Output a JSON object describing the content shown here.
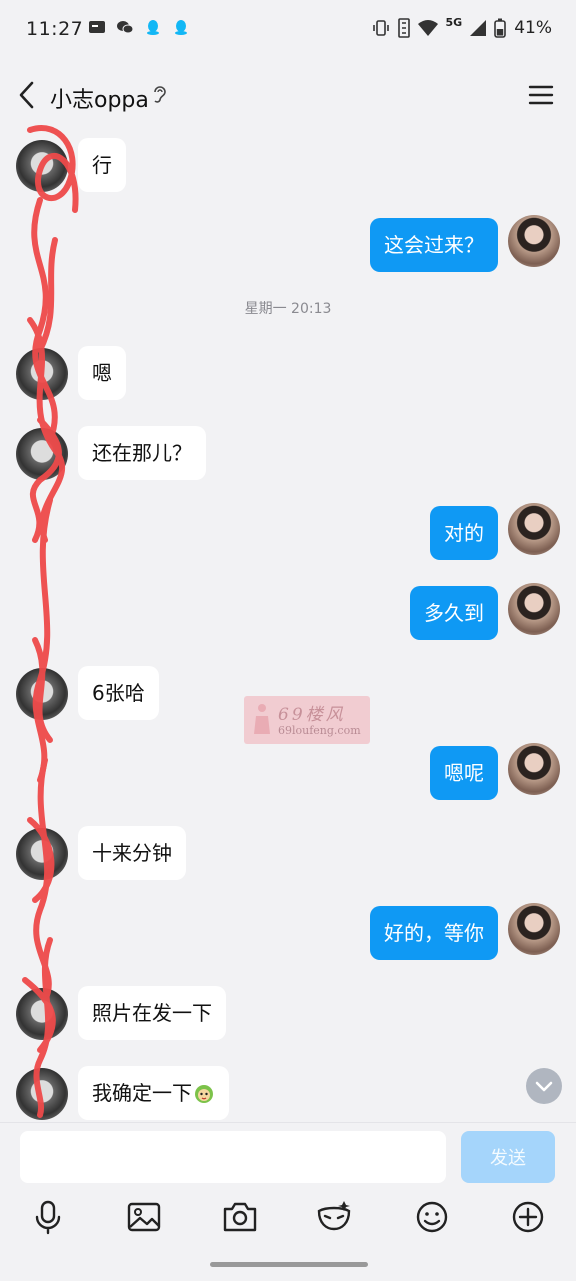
{
  "status": {
    "time": "11:27",
    "network": "5G",
    "battery": "41%"
  },
  "header": {
    "title": "小志oppa"
  },
  "timestamp": "星期一 20:13",
  "messages": [
    {
      "side": "recv",
      "text": "行"
    },
    {
      "side": "sent",
      "text": "这会过来？"
    },
    {
      "side": "recv",
      "text": "嗯"
    },
    {
      "side": "recv",
      "text": "还在那儿？"
    },
    {
      "side": "sent",
      "text": "对的"
    },
    {
      "side": "sent",
      "text": "多久到"
    },
    {
      "side": "recv",
      "text": "6张哈"
    },
    {
      "side": "sent",
      "text": "嗯呢"
    },
    {
      "side": "recv",
      "text": "十来分钟"
    },
    {
      "side": "sent",
      "text": "好的，等你"
    },
    {
      "side": "recv",
      "text": "照片在发一下"
    },
    {
      "side": "recv",
      "text": "我确定一下",
      "emoji": "sticker-face-icon"
    }
  ],
  "watermark": {
    "title": "69楼风",
    "url": "69loufeng.com"
  },
  "input": {
    "value": "",
    "send_label": "发送"
  },
  "toolbar": [
    "mic-icon",
    "image-icon",
    "camera-icon",
    "mask-icon",
    "emoji-icon",
    "plus-icon"
  ],
  "colors": {
    "sent_bubble": "#0f99f4",
    "recv_bubble": "#ffffff",
    "send_button": "#a5d5fb",
    "background": "#f2f2f4"
  }
}
